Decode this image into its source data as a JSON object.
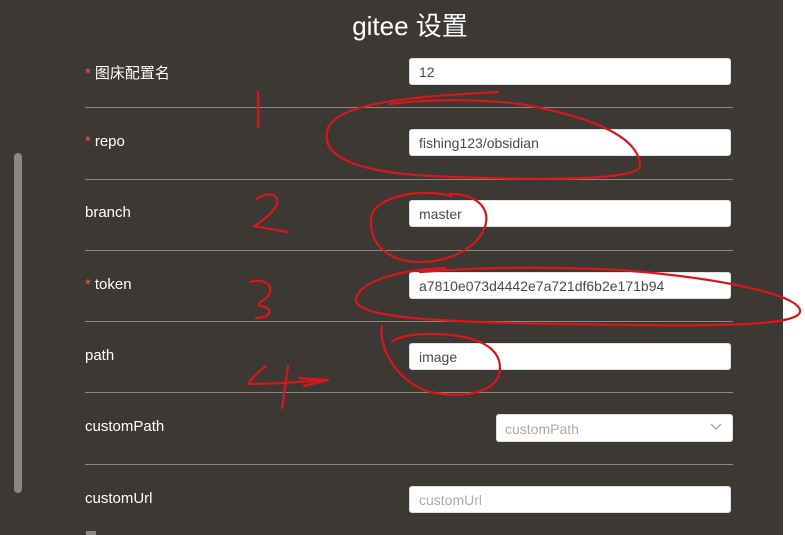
{
  "dialog": {
    "title": "gitee 设置",
    "required_mark": "*",
    "fields": [
      {
        "label": "图床配置名",
        "required": true,
        "value": "12"
      },
      {
        "label": "repo",
        "required": true,
        "value": "fishing123/obsidian"
      },
      {
        "label": "branch",
        "required": false,
        "value": "master"
      },
      {
        "label": "token",
        "required": true,
        "value": "a7810e073d4442e7a721df6b2e171b94"
      },
      {
        "label": "path",
        "required": false,
        "value": "image"
      },
      {
        "label": "customPath",
        "required": false,
        "placeholder": "customPath",
        "control": "select"
      },
      {
        "label": "customUrl",
        "required": false,
        "placeholder": "customUrl"
      }
    ]
  },
  "colors": {
    "background": "#3c3834",
    "annotation": "#d9161b",
    "required": "#ff4d4f"
  },
  "icons": {
    "select_arrow": "chevron-down-icon"
  }
}
